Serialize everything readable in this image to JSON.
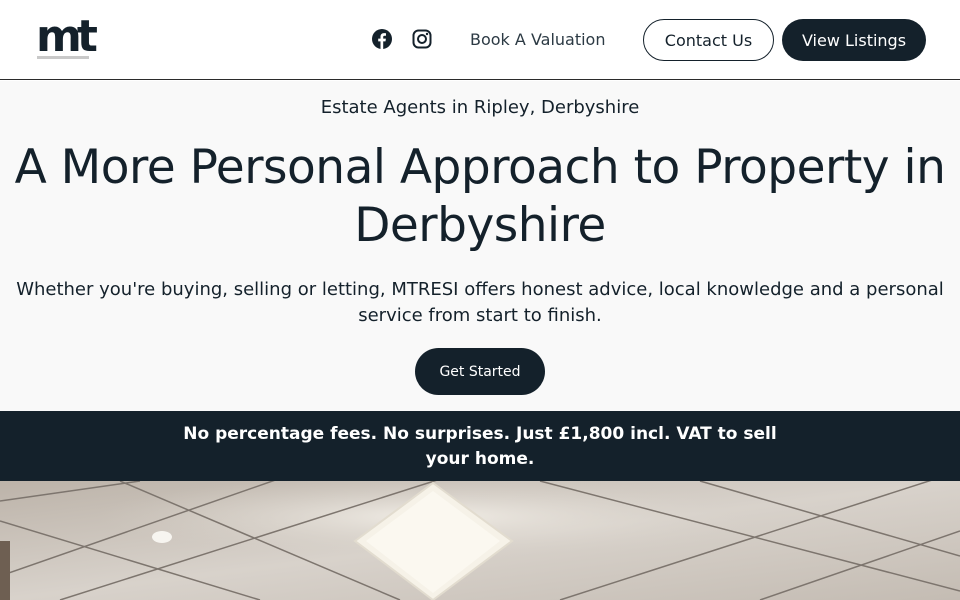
{
  "header": {
    "logo_text": "mt",
    "social": [
      {
        "icon": "facebook-icon"
      },
      {
        "icon": "instagram-icon"
      }
    ],
    "nav_link": "Book A Valuation",
    "contact_label": "Contact Us",
    "listings_label": "View Listings"
  },
  "hero": {
    "subtitle": "Estate Agents in Ripley, Derbyshire",
    "title": "A More Personal Approach to Property in Derbyshire",
    "description": "Whether you're buying, selling or letting, MTRESI offers honest advice, local knowledge and a personal service from start to finish.",
    "cta_label": "Get Started"
  },
  "banner": {
    "text": "No percentage fees. No surprises. Just £1,800 incl. VAT to sell your home."
  },
  "colors": {
    "brand_dark": "#14212b",
    "hero_bg": "#f9f9f9"
  }
}
